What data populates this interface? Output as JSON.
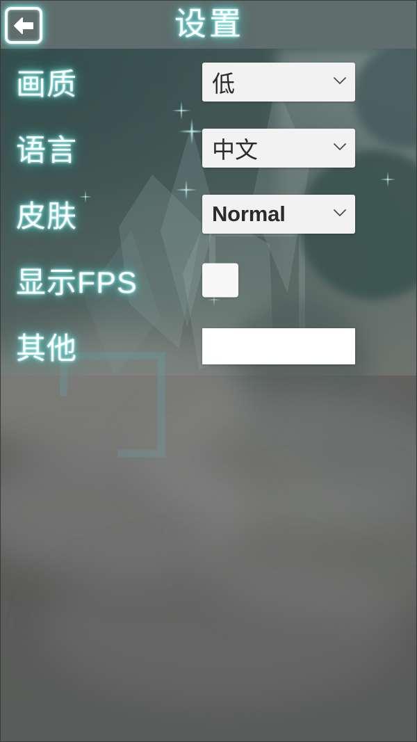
{
  "header": {
    "title": "设置",
    "back_icon": "arrow-left-icon"
  },
  "theme": {
    "glow_cyan": "#6ee8e6",
    "header_bar": "#5f6d6c",
    "panel_teal": "#3e5452",
    "control_bg": "#f2f2f2",
    "control_text": "#2b2b2b",
    "page_bottom": "#5a5c5b"
  },
  "settings": {
    "rows": [
      {
        "key": "graphics-quality",
        "label": "画质",
        "control": "select",
        "value": "低",
        "chevron_icon": "chevron-down-icon"
      },
      {
        "key": "language",
        "label": "语言",
        "control": "select",
        "value": "中文",
        "chevron_icon": "chevron-down-icon"
      },
      {
        "key": "skin",
        "label": "皮肤",
        "control": "select",
        "value": "Normal",
        "latin": true,
        "chevron_icon": "chevron-down-icon"
      },
      {
        "key": "show-fps",
        "label": "显示FPS",
        "control": "checkbox",
        "checked": false
      },
      {
        "key": "other",
        "label": "其他",
        "control": "text",
        "value": "",
        "placeholder": ""
      }
    ]
  }
}
